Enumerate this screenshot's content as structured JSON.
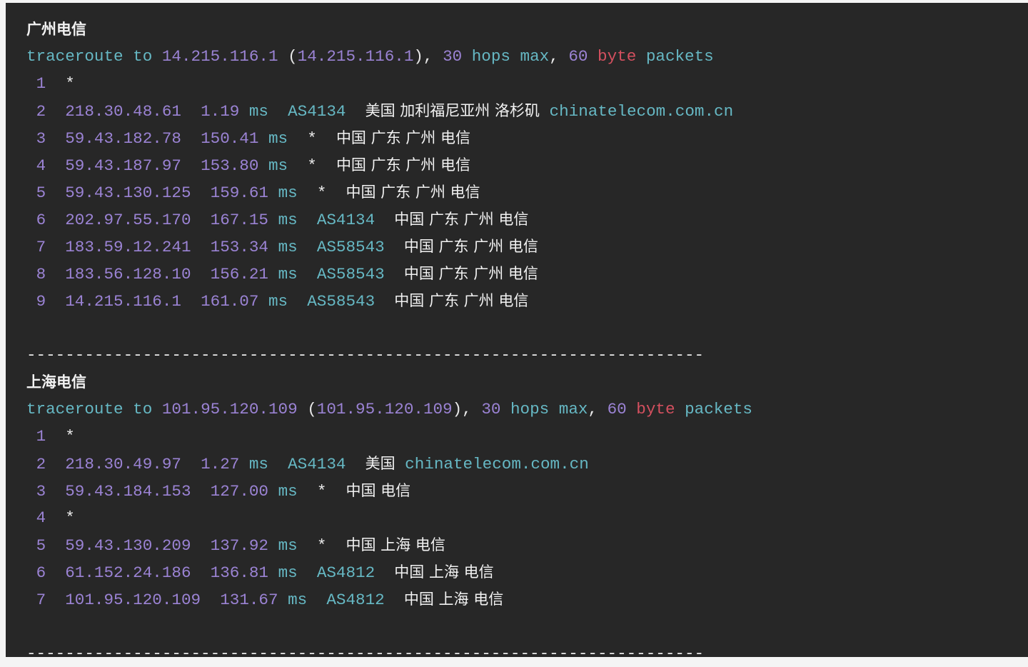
{
  "colors": {
    "background": "#272727",
    "keyword": "#66b8c4",
    "number": "#9b83d4",
    "highlight": "#d4505f",
    "text": "#ececec"
  },
  "separator": "----------------------------------------------------------------------",
  "sections": [
    {
      "title": "广州电信",
      "header": {
        "cmd": "traceroute",
        "to": "to",
        "target": "14.215.116.1",
        "target_paren": "14.215.116.1",
        "hops_num": "30",
        "hops_text": "hops max",
        "bytes_num": "60",
        "byte_word": "byte",
        "packets": "packets"
      },
      "hops": [
        {
          "n": "1",
          "star": "*"
        },
        {
          "n": "2",
          "ip": "218.30.48.61",
          "rtt": "1.19",
          "unit": "ms",
          "asn": "AS4134",
          "geo": "美国 加利福尼亚州 洛杉矶",
          "host": "chinatelecom.com.cn"
        },
        {
          "n": "3",
          "ip": "59.43.182.78",
          "rtt": "150.41",
          "unit": "ms",
          "asn": "*",
          "geo": "中国 广东 广州 电信"
        },
        {
          "n": "4",
          "ip": "59.43.187.97",
          "rtt": "153.80",
          "unit": "ms",
          "asn": "*",
          "geo": "中国 广东 广州 电信"
        },
        {
          "n": "5",
          "ip": "59.43.130.125",
          "rtt": "159.61",
          "unit": "ms",
          "asn": "*",
          "geo": "中国 广东 广州 电信"
        },
        {
          "n": "6",
          "ip": "202.97.55.170",
          "rtt": "167.15",
          "unit": "ms",
          "asn": "AS4134",
          "geo": "中国 广东 广州 电信"
        },
        {
          "n": "7",
          "ip": "183.59.12.241",
          "rtt": "153.34",
          "unit": "ms",
          "asn": "AS58543",
          "geo": "中国 广东 广州 电信"
        },
        {
          "n": "8",
          "ip": "183.56.128.10",
          "rtt": "156.21",
          "unit": "ms",
          "asn": "AS58543",
          "geo": "中国 广东 广州 电信"
        },
        {
          "n": "9",
          "ip": "14.215.116.1",
          "rtt": "161.07",
          "unit": "ms",
          "asn": "AS58543",
          "geo": "中国 广东 广州 电信"
        }
      ]
    },
    {
      "title": "上海电信",
      "header": {
        "cmd": "traceroute",
        "to": "to",
        "target": "101.95.120.109",
        "target_paren": "101.95.120.109",
        "hops_num": "30",
        "hops_text": "hops max",
        "bytes_num": "60",
        "byte_word": "byte",
        "packets": "packets"
      },
      "hops": [
        {
          "n": "1",
          "star": "*"
        },
        {
          "n": "2",
          "ip": "218.30.49.97",
          "rtt": "1.27",
          "unit": "ms",
          "asn": "AS4134",
          "geo": "美国",
          "host": "chinatelecom.com.cn"
        },
        {
          "n": "3",
          "ip": "59.43.184.153",
          "rtt": "127.00",
          "unit": "ms",
          "asn": "*",
          "geo": "中国 电信"
        },
        {
          "n": "4",
          "star": "*"
        },
        {
          "n": "5",
          "ip": "59.43.130.209",
          "rtt": "137.92",
          "unit": "ms",
          "asn": "*",
          "geo": "中国 上海 电信"
        },
        {
          "n": "6",
          "ip": "61.152.24.186",
          "rtt": "136.81",
          "unit": "ms",
          "asn": "AS4812",
          "geo": "中国 上海 电信"
        },
        {
          "n": "7",
          "ip": "101.95.120.109",
          "rtt": "131.67",
          "unit": "ms",
          "asn": "AS4812",
          "geo": "中国 上海 电信"
        }
      ]
    }
  ]
}
